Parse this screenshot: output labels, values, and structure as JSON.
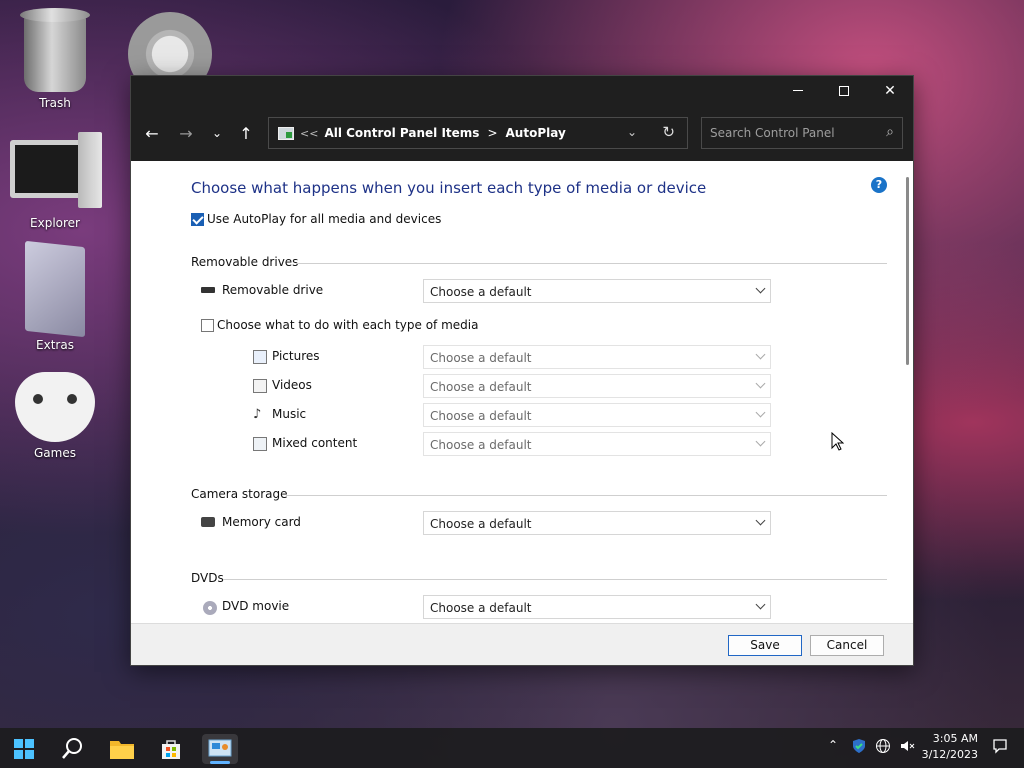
{
  "desktop": {
    "icons": [
      {
        "label": "Trash"
      },
      {
        "label": "Explorer"
      },
      {
        "label": "Extras"
      },
      {
        "label": "Games"
      }
    ]
  },
  "window": {
    "address": {
      "overflow": "<<",
      "crumbs": [
        "All Control Panel Items",
        "AutoPlay"
      ],
      "separator": ">"
    },
    "search": {
      "placeholder": "Search Control Panel"
    },
    "heading": "Choose what happens when you insert each type of media or device",
    "use_autoplay": {
      "label": "Use AutoPlay for all media and devices",
      "checked": true
    },
    "sections": {
      "removable": {
        "title": "Removable drives",
        "drive": {
          "label": "Removable drive",
          "value": "Choose a default"
        },
        "per_media": {
          "label": "Choose what to do with each type of media",
          "checked": false
        },
        "media": [
          {
            "label": "Pictures",
            "value": "Choose a default"
          },
          {
            "label": "Videos",
            "value": "Choose a default"
          },
          {
            "label": "Music",
            "value": "Choose a default"
          },
          {
            "label": "Mixed content",
            "value": "Choose a default"
          }
        ]
      },
      "camera": {
        "title": "Camera storage",
        "memory_card": {
          "label": "Memory card",
          "value": "Choose a default"
        }
      },
      "dvds": {
        "title": "DVDs",
        "dvd_movie": {
          "label": "DVD movie",
          "value": "Choose a default"
        }
      }
    },
    "footer": {
      "save": "Save",
      "cancel": "Cancel"
    }
  },
  "taskbar": {
    "time": "3:05 AM",
    "date": "3/12/2023"
  },
  "colors": {
    "accent": "#1a5fb4",
    "heading": "#1e3287",
    "titlebar": "#1f1f1f"
  }
}
